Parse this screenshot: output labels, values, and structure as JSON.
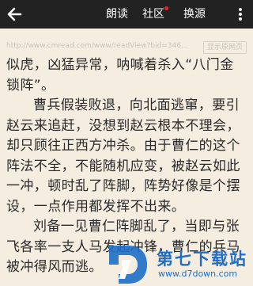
{
  "toolbar": {
    "back_icon": "arrow-left-icon",
    "read_aloud": "朗读",
    "community": "社区",
    "change_source": "换源",
    "more_icon": "more-vertical-icon",
    "badge_color": "#e02828"
  },
  "source_bar": {
    "url": "http://www.cmread.com/www/readView?bid=346...",
    "open_original": "显示原网页"
  },
  "article": {
    "paragraphs": [
      "似虎，凶猛异常，呐喊着杀入“八门金锁阵”。",
      "曹兵假装败退，向北面逃窜，要引赵云来追赶，没想到赵云根本不理会，却只顾往正西方冲杀。由于曹仁的这个阵法不全，不能随机应变，被赵云如此一冲，顿时乱了阵脚，阵势好像是个摆设，一点作用都发挥不出来。",
      "刘备一见曹仁阵脚乱了，当即与张飞各率一支人马发起冲锋，曹仁的兵马被冲得风而逃。"
    ]
  },
  "watermark": {
    "logo_icon": "d7-logo-icon",
    "name": "第七下载站",
    "site": "www.d7down.com",
    "color": "#1e6ec8"
  }
}
